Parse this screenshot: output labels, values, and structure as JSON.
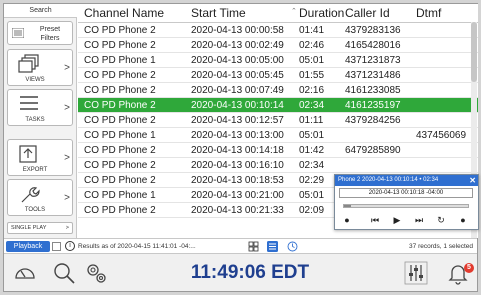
{
  "sidebar": {
    "search_tab": "Search",
    "preset_filters": "Preset Filters",
    "views": "VIEWS",
    "tasks": "TASKS",
    "export": "EXPORT",
    "tools": "TOOLS",
    "single_play": "SINGLE PLAY",
    "arrow": ">"
  },
  "table": {
    "columns": [
      "Channel Name",
      "Start Time",
      "Duration",
      "Caller Id",
      "Dtmf"
    ],
    "sorted_column": "Duration",
    "rows": [
      [
        "CO PD Phone 2",
        "2020-04-13 00:00:58",
        "01:41",
        "4379283136",
        ""
      ],
      [
        "CO PD Phone 2",
        "2020-04-13 00:02:49",
        "02:46",
        "4165428016",
        ""
      ],
      [
        "CO PD Phone 1",
        "2020-04-13 00:05:00",
        "05:01",
        "4371231873",
        ""
      ],
      [
        "CO PD Phone 2",
        "2020-04-13 00:05:45",
        "01:55",
        "4371231486",
        ""
      ],
      [
        "CO PD Phone 2",
        "2020-04-13 00:07:49",
        "02:16",
        "4161233085",
        ""
      ],
      [
        "CO PD Phone 2",
        "2020-04-13 00:10:14",
        "02:34",
        "4161235197",
        ""
      ],
      [
        "CO PD Phone 2",
        "2020-04-13 00:12:57",
        "01:11",
        "4379284256",
        ""
      ],
      [
        "CO PD Phone 1",
        "2020-04-13 00:13:00",
        "05:01",
        "",
        "437456069"
      ],
      [
        "CO PD Phone 2",
        "2020-04-13 00:14:18",
        "01:42",
        "6479285890",
        ""
      ],
      [
        "CO PD Phone 2",
        "2020-04-13 00:16:10",
        "02:34",
        "",
        ""
      ],
      [
        "CO PD Phone 2",
        "2020-04-13 00:18:53",
        "02:29",
        "",
        ""
      ],
      [
        "CO PD Phone 1",
        "2020-04-13 00:21:00",
        "05:01",
        "",
        ""
      ],
      [
        "CO PD Phone 2",
        "2020-04-13 00:21:33",
        "02:09",
        "",
        ""
      ]
    ],
    "selected_row": 5
  },
  "player": {
    "title": "Phone 2     2020-04-13 00:10:14 • 02:34",
    "close": "✕",
    "timestamp": "2020-04-13 00:10:18 -04:00",
    "progress": 0.06
  },
  "status": {
    "playback": "Playback",
    "info": "i",
    "results_text": "Results as of 2020-04-15 11:41:01 -04:...",
    "records": "37 records, 1 selected"
  },
  "bottom": {
    "clock": "11:49:06 EDT",
    "notification_count": "5"
  },
  "colors": {
    "selected_row": "#2fa83a",
    "accent_blue": "#2f6fd0",
    "clock_text": "#1f3f8f",
    "badge": "#e23a2e"
  }
}
